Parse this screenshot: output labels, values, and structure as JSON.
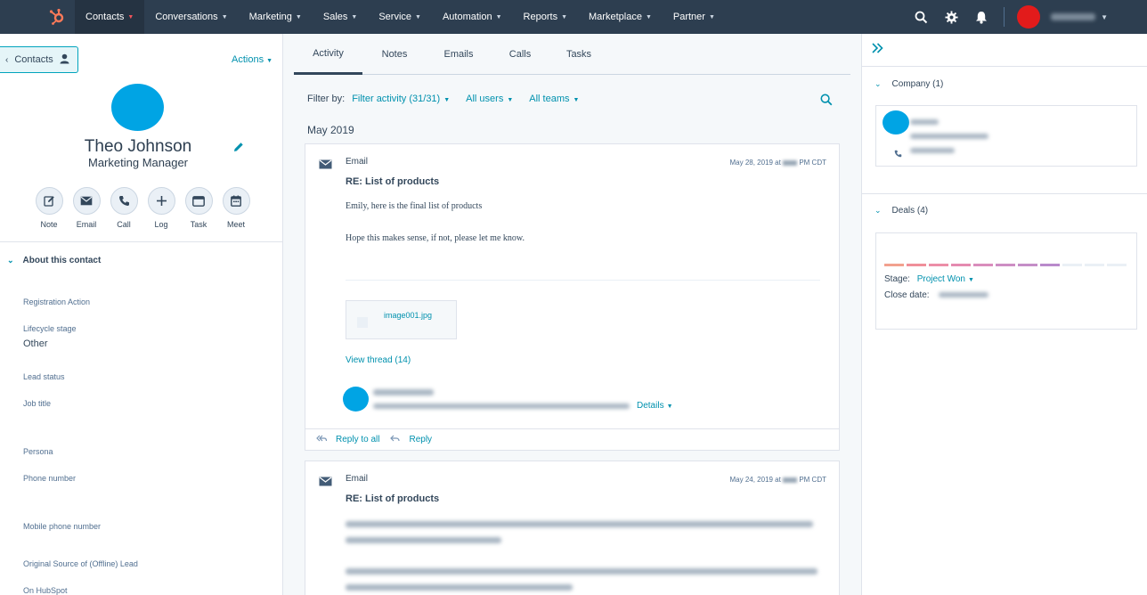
{
  "nav": {
    "logo_icon": "hubspot-sprocket-icon",
    "items": [
      {
        "label": "Contacts"
      },
      {
        "label": "Conversations"
      },
      {
        "label": "Marketing"
      },
      {
        "label": "Sales"
      },
      {
        "label": "Service"
      },
      {
        "label": "Automation"
      },
      {
        "label": "Reports"
      },
      {
        "label": "Marketplace"
      },
      {
        "label": "Partner"
      }
    ],
    "right_icons": [
      "search-icon",
      "gear-icon",
      "bell-icon"
    ]
  },
  "left": {
    "back_label": "Contacts",
    "actions_label": "Actions",
    "name": "Theo Johnson",
    "role": "Marketing Manager",
    "quick_actions": [
      {
        "label": "Note",
        "icon": "pencil-icon"
      },
      {
        "label": "Email",
        "icon": "envelope-icon"
      },
      {
        "label": "Call",
        "icon": "phone-icon"
      },
      {
        "label": "Log",
        "icon": "plus-icon"
      },
      {
        "label": "Task",
        "icon": "task-icon"
      },
      {
        "label": "Meet",
        "icon": "calendar-icon"
      }
    ],
    "about_label": "About this contact",
    "properties": [
      {
        "label": "Registration Action",
        "value": ""
      },
      {
        "label": "Lifecycle stage",
        "value": "Other"
      },
      {
        "label": "Lead status",
        "value": ""
      },
      {
        "label": "Job title",
        "value": ""
      },
      {
        "label": "Persona",
        "value": ""
      },
      {
        "label": "Phone number",
        "value": ""
      },
      {
        "label": "Mobile phone number",
        "value": ""
      },
      {
        "label": "Original Source of (Offline) Lead",
        "value": ""
      },
      {
        "label": "On HubSpot",
        "value": ""
      }
    ]
  },
  "middle": {
    "tabs": [
      {
        "label": "Activity"
      },
      {
        "label": "Notes"
      },
      {
        "label": "Emails"
      },
      {
        "label": "Calls"
      },
      {
        "label": "Tasks"
      }
    ],
    "filter_by_label": "Filter by:",
    "filters": [
      {
        "label": "Filter activity (31/31)"
      },
      {
        "label": "All users"
      },
      {
        "label": "All teams"
      }
    ],
    "month": "May 2019",
    "card1": {
      "type": "Email",
      "date_prefix": "May 28, 2019 at",
      "date_suffix": "PM CDT",
      "subject": "RE: List of products",
      "body_lines": [
        "Emily, here is the final list of products",
        "Hope this makes sense, if not, please let me know."
      ],
      "attachment": "image001.jpg",
      "view_thread": "View thread (14)",
      "details_label": "Details",
      "reply_all": "Reply to all",
      "reply": "Reply"
    },
    "card2": {
      "type": "Email",
      "date_prefix": "May 24, 2019 at",
      "date_suffix": "PM CDT",
      "subject": "RE: List of products"
    }
  },
  "right": {
    "company_label": "Company (1)",
    "deals_label": "Deals (4)",
    "stage_label": "Stage:",
    "stage_value": "Project Won",
    "close_date_label": "Close date:",
    "pipeline_colors": [
      "#f2a18e",
      "#f08f9a",
      "#ec8ea8",
      "#e58bb0",
      "#d98dbc",
      "#cd8ec4",
      "#c58ec8",
      "#b98acb",
      "#eaf0f6",
      "#eaf0f6",
      "#eaf0f6"
    ]
  }
}
